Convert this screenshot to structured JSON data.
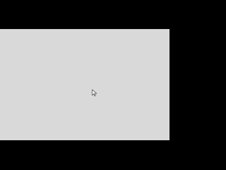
{
  "screen": {
    "letterbox_color": "#000000",
    "background_color": "#d9d9d9"
  },
  "cursor": {
    "icon": "arrow-pointer-icon",
    "fill_color": "#ffffff",
    "outline_color": "#555555"
  }
}
